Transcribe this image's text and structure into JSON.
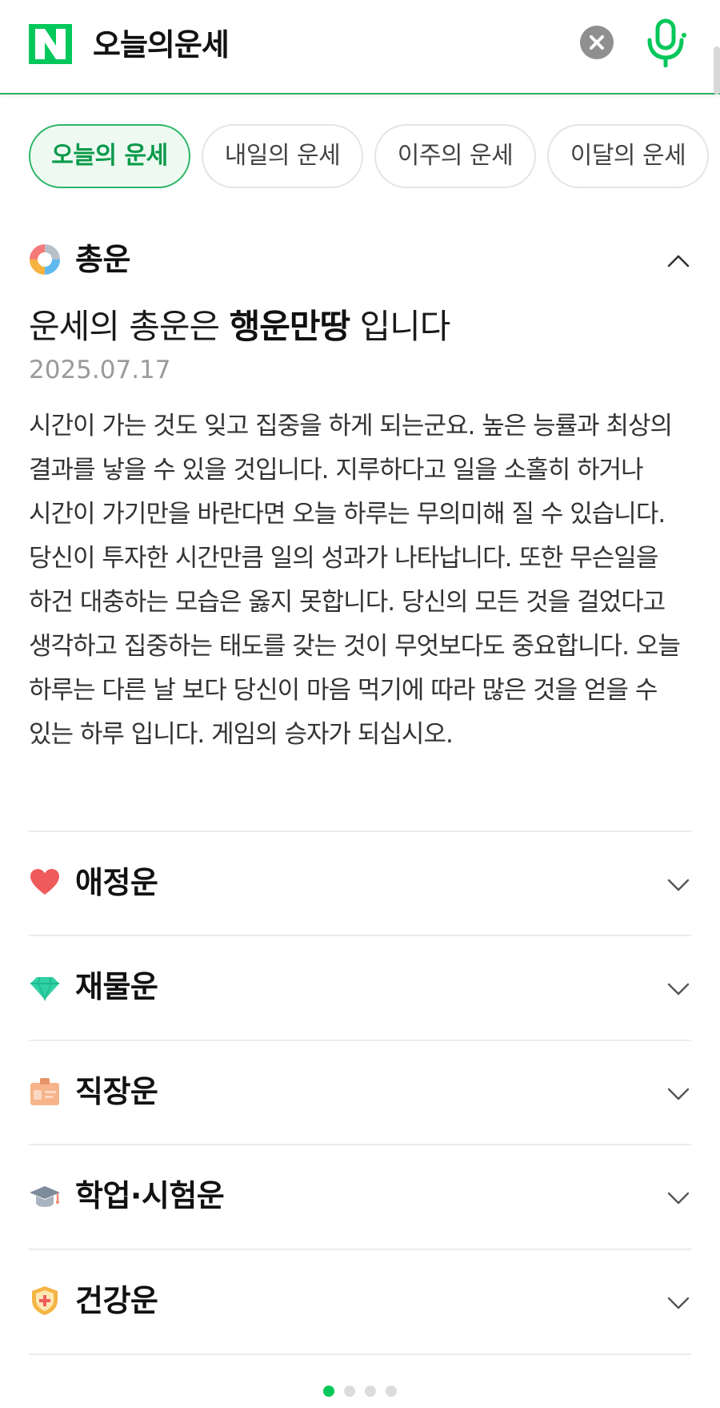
{
  "search": {
    "query": "오늘의운세"
  },
  "tabs": [
    {
      "label": "오늘의 운세",
      "active": true
    },
    {
      "label": "내일의 운세",
      "active": false
    },
    {
      "label": "이주의 운세",
      "active": false
    },
    {
      "label": "이달의 운세",
      "active": false
    }
  ],
  "overall": {
    "title": "총운",
    "headline_prefix": "운세의 총운은",
    "headline_emph": "행운만땅",
    "headline_suffix": "입니다",
    "date": "2025.07.17",
    "body": "시간이 가는 것도 잊고 집중을 하게 되는군요. 높은 능률과 최상의 결과를 낳을 수 있을 것입니다. 지루하다고 일을 소홀히 하거나 시간이 가기만을 바란다면 오늘 하루는 무의미해 질 수 있습니다. 당신이 투자한 시간만큼 일의 성과가 나타납니다. 또한 무슨일을 하건 대충하는 모습은 옳지 못합니다. 당신의 모든 것을 걸었다고 생각하고 집중하는 태도를 갖는 것이 무엇보다도 중요합니다. 오늘 하루는 다른 날 보다 당신이 마음 먹기에 따라 많은 것을 얻을 수 있는 하루 입니다. 게임의 승자가 되십시오."
  },
  "sections": [
    {
      "title": "애정운",
      "icon": "heart-icon"
    },
    {
      "title": "재물운",
      "icon": "diamond-icon"
    },
    {
      "title": "직장운",
      "icon": "id-badge-icon"
    },
    {
      "title": "학업·시험운",
      "icon": "graduation-cap-icon"
    },
    {
      "title": "건강운",
      "icon": "health-shield-icon"
    }
  ],
  "pager": {
    "count": 4,
    "active": 1
  },
  "colors": {
    "brand": "#03c75a",
    "active_tab_bg": "#eef9f2",
    "active_tab_border": "#2bb566",
    "divider": "#ececec",
    "heart": "#ef5b5b",
    "diamond": "#2fd1a5",
    "badge": "#f7b48b",
    "cap": "#7e8b9b",
    "shield": "#f4b544"
  }
}
